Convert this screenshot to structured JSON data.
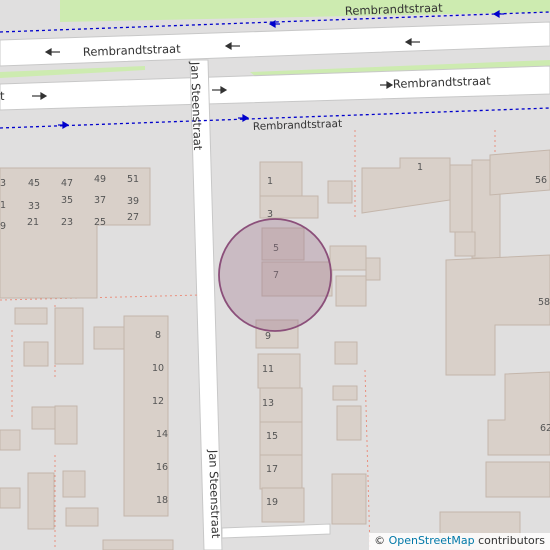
{
  "map": {
    "street_labels": {
      "rembrandt_top": "Rembrandtstraat",
      "rembrandt_mid": "Rembrandtstraat",
      "rembrandt_right": "Rembrandtstraat",
      "rembrandt_lower": "Rembrandtstraat",
      "rembrandt_left_partial": "t",
      "jan_steen_upper": "Jan Steenstraat",
      "jan_steen_lower": "Jan Steenstraat"
    },
    "house_numbers": {
      "n3a": "3",
      "n45": "45",
      "n47": "47",
      "n49": "49",
      "n51": "51",
      "n1a": "1",
      "n33": "33",
      "n35": "35",
      "n37": "37",
      "n39": "39",
      "n9a": "9",
      "n21": "21",
      "n23": "23",
      "n25": "25",
      "n27": "27",
      "n8": "8",
      "n10": "10",
      "n12": "12",
      "n14": "14",
      "n16": "16",
      "n18": "18",
      "n1": "1",
      "n3": "3",
      "n5": "5",
      "n7": "7",
      "n9": "9",
      "n11": "11",
      "n13": "13",
      "n15": "15",
      "n17": "17",
      "n19": "19",
      "n1b": "1",
      "n56": "56",
      "n58": "58",
      "n62": "62"
    },
    "marker_color": "#a0788e",
    "building_color": "#d9d0c9",
    "road_color": "#ffffff",
    "path_color": "#0000cc",
    "boundary_color": "#e9907f",
    "grass_color": "#cdebb0"
  },
  "attribution": {
    "symbol": "©",
    "link": "OpenStreetMap",
    "suffix": "contributors"
  }
}
